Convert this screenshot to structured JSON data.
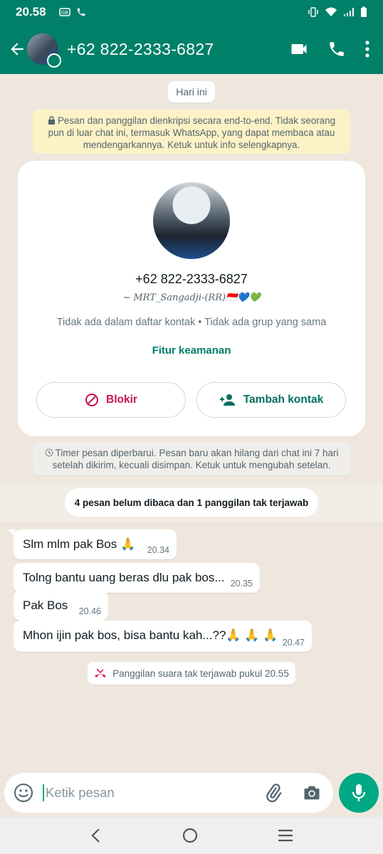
{
  "status_bar": {
    "time": "20.58"
  },
  "header": {
    "title": "+62 822-2333-6827"
  },
  "chat": {
    "day_chip": "Hari ini",
    "encryption_notice": "Pesan dan panggilan dienkripsi secara end-to-end. Tidak seorang pun di luar chat ini, termasuk WhatsApp, yang dapat membaca atau mendengarkannya. Ketuk untuk info selengkapnya.",
    "profile_card": {
      "phone": "+62 822-2333-6827",
      "about": "~ MRT_Sangadji-(RR)🇮🇩💙💚",
      "meta": "Tidak ada dalam daftar kontak • Tidak ada grup yang sama",
      "security_link": "Fitur keamanan",
      "block_label": "Blokir",
      "add_contact_label": "Tambah kontak"
    },
    "timer_notice": "Timer pesan diperbarui. Pesan baru akan hilang dari chat ini 7 hari setelah dikirim, kecuali disimpan. Ketuk untuk mengubah setelan.",
    "unread_chip": "4 pesan belum dibaca dan 1 panggilan tak terjawab",
    "messages": [
      {
        "text": "Slm mlm pak Bos 🙏",
        "time": "20.34"
      },
      {
        "text": "Tolng bantu uang beras dlu pak bos...",
        "time": "20.35"
      },
      {
        "text": "Pak Bos",
        "time": "20.46"
      },
      {
        "text": "Mhon ijin pak bos, bisa bantu kah...??🙏 🙏 🙏",
        "time": "20.47"
      }
    ],
    "missed_call": "Panggilan suara tak terjawab pukul 20.55"
  },
  "composer": {
    "placeholder": "Ketik pesan"
  },
  "colors": {
    "header": "#008069",
    "accent": "#00a884",
    "block": "#c5164a"
  },
  "icons": [
    "back-arrow-icon",
    "video-call-icon",
    "voice-call-icon",
    "menu-dots-icon",
    "lock-icon",
    "block-icon",
    "add-contact-icon",
    "timer-icon",
    "missed-call-icon",
    "emoji-icon",
    "attach-icon",
    "camera-icon",
    "mic-icon",
    "nav-back-icon",
    "nav-home-icon",
    "nav-recents-icon"
  ]
}
